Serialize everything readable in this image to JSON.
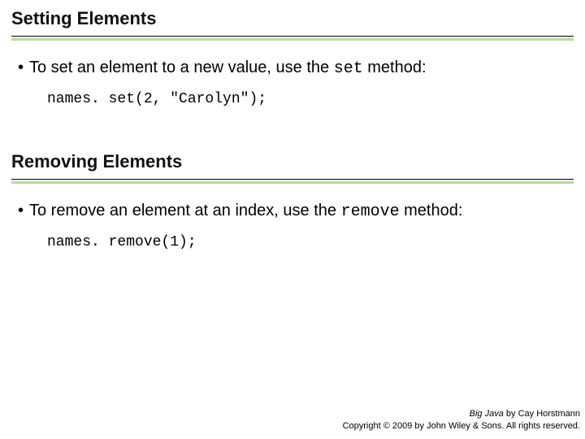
{
  "section1": {
    "heading": "Setting Elements",
    "bullet_pre": "To set an element to a new value, use the ",
    "bullet_code": "set",
    "bullet_post": "  method:",
    "code": "names. set(2, \"Carolyn\");"
  },
  "section2": {
    "heading": "Removing Elements",
    "bullet_pre": "To remove an element at an index, use the ",
    "bullet_code": "remove",
    "bullet_post": "  method:",
    "code": "names. remove(1);"
  },
  "footer": {
    "title": "Big Java",
    "byline": " by Cay Horstmann",
    "copyright": "Copyright © 2009 by John Wiley & Sons. All rights reserved."
  }
}
